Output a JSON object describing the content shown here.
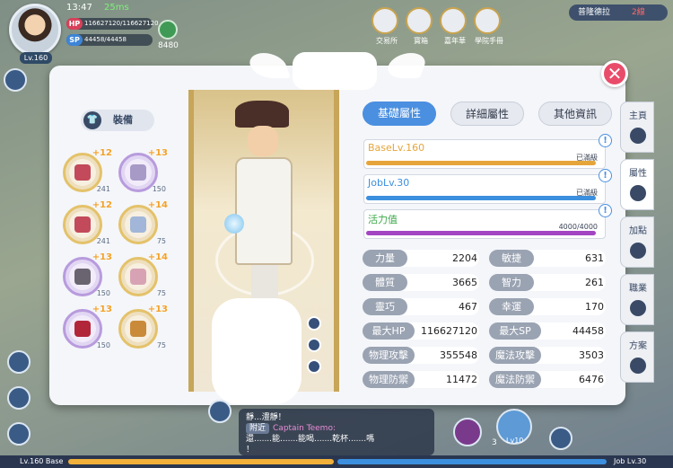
{
  "hud": {
    "time": "13:47",
    "ping": "25ms",
    "hp_tag": "HP",
    "hp_value": "116627120/116627120",
    "sp_tag": "SP",
    "sp_value": "44458/44458",
    "level": "Lv.160",
    "currency": "8480",
    "top_icons": [
      "交易所",
      "寶箱",
      "嘉年華",
      "學院手冊"
    ],
    "map_name": "普隆德拉",
    "channel": "2線"
  },
  "equipment": {
    "header": "裝備",
    "slots": [
      {
        "refine": "+12",
        "num": "241",
        "frame": "gold",
        "color": "#c24a5a"
      },
      {
        "refine": "+13",
        "num": "150",
        "frame": "purple",
        "color": "#a79ac7"
      },
      {
        "refine": "+12",
        "num": "241",
        "frame": "gold",
        "color": "#c24a5a"
      },
      {
        "refine": "+14",
        "num": "75",
        "frame": "gold",
        "color": "#a1b6d8"
      },
      {
        "refine": "+13",
        "num": "150",
        "frame": "purple",
        "color": "#6a6370"
      },
      {
        "refine": "+14",
        "num": "75",
        "frame": "gold",
        "color": "#d7a3b4"
      },
      {
        "refine": "+13",
        "num": "150",
        "frame": "purple",
        "color": "#b2263a"
      },
      {
        "refine": "+13",
        "num": "75",
        "frame": "gold",
        "color": "#c98a3a"
      }
    ]
  },
  "tabs": {
    "basic": "基礎屬性",
    "detail": "詳細屬性",
    "other": "其他資訊"
  },
  "levels": {
    "base": {
      "label": "BaseLv.160",
      "status": "已滿級",
      "color": "#e6a53a",
      "progress": 1.0
    },
    "job": {
      "label": "JobLv.30",
      "status": "已滿級",
      "color": "#3b8fde",
      "progress": 1.0
    },
    "vitality": {
      "label": "活力值",
      "status": "4000/4000",
      "color": "#a345c2",
      "progress": 1.0
    }
  },
  "stats": [
    {
      "k": "力量",
      "v": "2204"
    },
    {
      "k": "敏捷",
      "v": "631"
    },
    {
      "k": "體質",
      "v": "3665"
    },
    {
      "k": "智力",
      "v": "261"
    },
    {
      "k": "靈巧",
      "v": "467"
    },
    {
      "k": "幸運",
      "v": "170"
    },
    {
      "k": "最大HP",
      "v": "116627120"
    },
    {
      "k": "最大SP",
      "v": "44458"
    },
    {
      "k": "物理攻擊",
      "v": "355548"
    },
    {
      "k": "魔法攻擊",
      "v": "3503"
    },
    {
      "k": "物理防禦",
      "v": "11472"
    },
    {
      "k": "魔法防禦",
      "v": "6476"
    }
  ],
  "right_tabs": [
    "主頁",
    "屬性",
    "加點",
    "職業",
    "方案"
  ],
  "chat": {
    "line1": "靜...澧靜！",
    "channel": "附近",
    "name": "Captain Teemo:",
    "line2": "還.......能.......能喝.......乾杯.......嗎",
    "line3": "！"
  },
  "bottom": {
    "base": "Lv.160 Base",
    "job": "Job Lv.30",
    "skill_level": "Lv10",
    "counter": "3"
  }
}
